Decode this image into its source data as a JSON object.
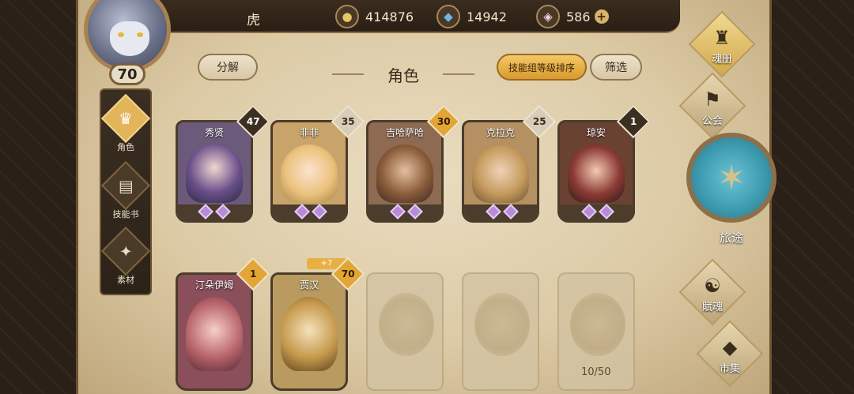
{
  "player": {
    "name": "虎",
    "level": "70"
  },
  "resources": [
    {
      "icon": "gold-coin-icon",
      "value": "414876"
    },
    {
      "icon": "blue-crystal-icon",
      "value": "14942"
    },
    {
      "icon": "pink-gem-icon",
      "value": "586"
    }
  ],
  "left_menu": [
    {
      "icon": "character-icon",
      "label": "角色",
      "active": true
    },
    {
      "icon": "skill-book-icon",
      "label": "技能书",
      "active": false
    },
    {
      "icon": "material-icon",
      "label": "素材",
      "active": false
    }
  ],
  "header": {
    "decompose": "分解",
    "title": "角色",
    "sort": "技能组等级排序",
    "filter": "筛选"
  },
  "characters": [
    {
      "name": "秀贤",
      "count": "47",
      "badge": "dark"
    },
    {
      "name": "非非",
      "count": "35",
      "badge": "light"
    },
    {
      "name": "吉哈萨哈",
      "count": "30",
      "badge": "gold"
    },
    {
      "name": "克拉克",
      "count": "25",
      "badge": "light"
    },
    {
      "name": "琼安",
      "count": "1",
      "badge": "dark"
    },
    {
      "name": "汀朵伊姆",
      "count": "1",
      "badge": "gold"
    },
    {
      "name": "贾汉",
      "count": "70",
      "badge": "gold",
      "bonus": "+7"
    }
  ],
  "collection_progress": "10/50",
  "right_menu": [
    {
      "icon": "soul-book-icon",
      "label": "魂册"
    },
    {
      "icon": "guild-icon",
      "label": "公会"
    },
    {
      "icon": "journey-icon",
      "label": "旅途"
    },
    {
      "icon": "fusion-icon",
      "label": "賦魂"
    },
    {
      "icon": "market-icon",
      "label": "市集"
    }
  ],
  "colors": {
    "parchment": "#dccaa5",
    "gold_accent": "#e3a634",
    "dark_frame": "#3b2f22"
  }
}
